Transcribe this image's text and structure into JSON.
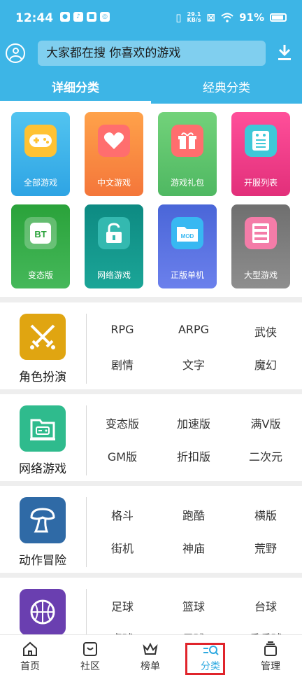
{
  "status_bar": {
    "time": "12:44",
    "net_speed_value": "29.1",
    "net_speed_unit": "KB/s",
    "battery": "91%"
  },
  "header": {
    "search_placeholder": "大家都在搜  你喜欢的游戏",
    "tabs": [
      {
        "label": "详细分类",
        "active": true
      },
      {
        "label": "经典分类",
        "active": false
      }
    ]
  },
  "grid": {
    "tiles": [
      {
        "label": "全部游戏",
        "icon": "gamepad-icon",
        "color": "#3cb0e6"
      },
      {
        "label": "中文游戏",
        "icon": "heart-icon",
        "color": "#f98a3b"
      },
      {
        "label": "游戏礼包",
        "icon": "gift-icon",
        "color": "#57c46a"
      },
      {
        "label": "开服列表",
        "icon": "list-icon",
        "color": "#e9508e"
      },
      {
        "label": "BT",
        "icon": "bt-icon",
        "color": "#3aa94a"
      },
      {
        "label": "变态版",
        "icon": "",
        "color": ""
      },
      {
        "label": "网络游戏",
        "icon": "unlock-icon",
        "color": "#0e9488"
      },
      {
        "label": "正版单机",
        "icon": "mod-folder-icon",
        "color": "#5671e0"
      },
      {
        "label": "大型游戏",
        "icon": "server-icon",
        "color": "#7d7d7d"
      }
    ]
  },
  "sections": [
    {
      "title": "角色扮演",
      "icon": "swords-icon",
      "icon_color": "#e0a511",
      "tags": [
        "RPG",
        "ARPG",
        "武侠",
        "剧情",
        "文字",
        "魔幻"
      ]
    },
    {
      "title": "网络游戏",
      "icon": "network-game-icon",
      "icon_color": "#2fbb8d",
      "tags": [
        "变态版",
        "加速版",
        "满V版",
        "GM版",
        "折扣版",
        "二次元"
      ]
    },
    {
      "title": "动作冒险",
      "icon": "mushroom-icon",
      "icon_color": "#2f6aa6",
      "tags": [
        "格斗",
        "跑酷",
        "横版",
        "街机",
        "神庙",
        "荒野"
      ]
    },
    {
      "title": "",
      "icon": "basketball-icon",
      "icon_color": "#6a3fb0",
      "tags": [
        "足球",
        "篮球",
        "台球",
        "桌球",
        "足球",
        "乒乓球"
      ]
    }
  ],
  "bottom_nav": [
    {
      "label": "首页",
      "icon": "home-icon"
    },
    {
      "label": "社区",
      "icon": "community-icon"
    },
    {
      "label": "榜单",
      "icon": "crown-icon"
    },
    {
      "label": "分类",
      "icon": "category-search-icon",
      "active": true
    },
    {
      "label": "管理",
      "icon": "manage-icon"
    }
  ],
  "colors": {
    "header_blue": "#3db5e6",
    "active_nav": "#2ea9e0",
    "highlight_red": "#e0242b"
  }
}
